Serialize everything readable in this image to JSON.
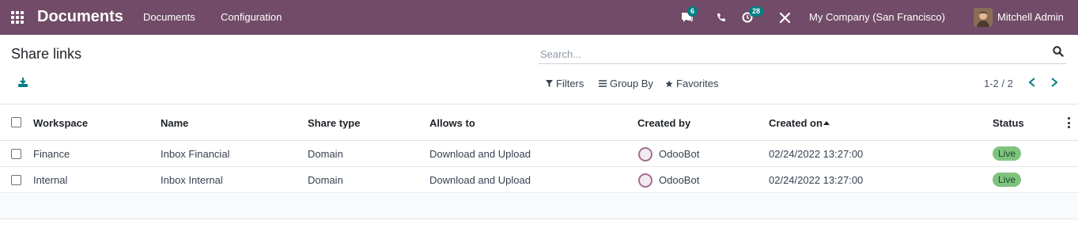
{
  "navbar": {
    "app_title": "Documents",
    "menus": [
      "Documents",
      "Configuration"
    ],
    "chat_badge": "6",
    "activity_badge": "28",
    "company": "My Company (San Francisco)",
    "user": "Mitchell Admin",
    "bg_color": "#714B67"
  },
  "control_panel": {
    "title": "Share links",
    "search_placeholder": "Search...",
    "filters_label": "Filters",
    "group_by_label": "Group By",
    "favorites_label": "Favorites",
    "pager": "1-2 / 2"
  },
  "table": {
    "columns": [
      "Workspace",
      "Name",
      "Share type",
      "Allows to",
      "Created by",
      "Created on",
      "Status"
    ],
    "rows": [
      {
        "workspace": "Finance",
        "name": "Inbox Financial",
        "share_type": "Domain",
        "allows_to": "Download and Upload",
        "created_by": "OdooBot",
        "created_on": "02/24/2022 13:27:00",
        "status": "Live"
      },
      {
        "workspace": "Internal",
        "name": "Inbox Internal",
        "share_type": "Domain",
        "allows_to": "Download and Upload",
        "created_by": "OdooBot",
        "created_on": "02/24/2022 13:27:00",
        "status": "Live"
      }
    ],
    "status_color": "#7fc37e"
  },
  "icons": [
    "apps-icon",
    "chat-icon",
    "phone-icon",
    "activity-icon",
    "tools-icon",
    "search-icon",
    "download-icon",
    "filter-icon",
    "group-by-icon",
    "star-icon",
    "chevron-left-icon",
    "chevron-right-icon",
    "sort-asc-icon",
    "kebab-icon"
  ]
}
